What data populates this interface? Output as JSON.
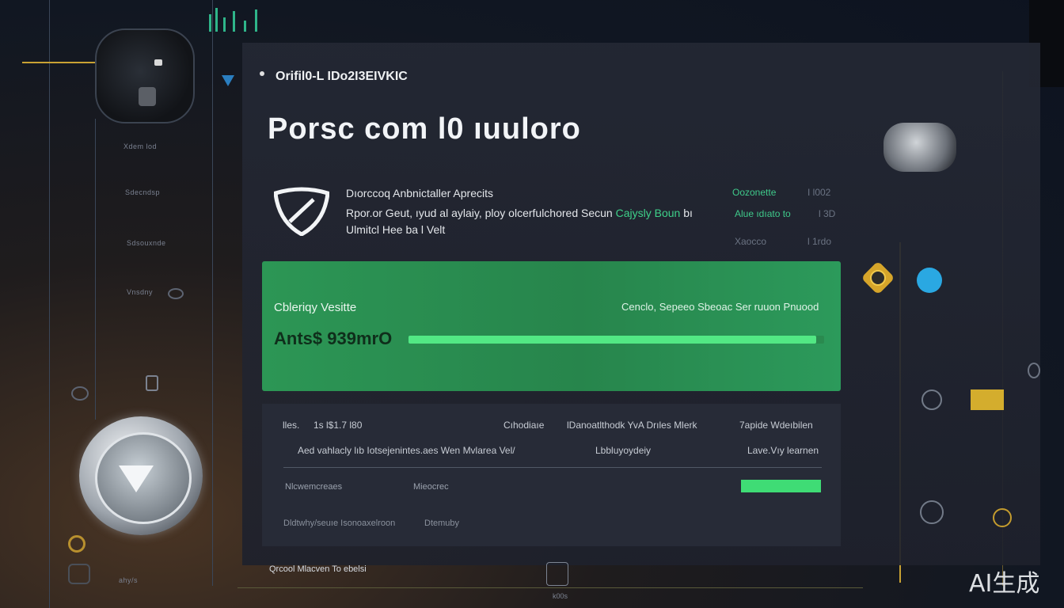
{
  "rail": {
    "labels": [
      "Xdem lod",
      "Sdecndsp",
      "Sdsouxnde",
      "Vnsdny"
    ]
  },
  "header": {
    "label": "Orifil0-L IDo2I3EIVKIC",
    "title": "Porsc com l0 ıuuloro"
  },
  "description": {
    "title": "Dıorccoq Anbnictaller Aprecits",
    "line1_prefix": "Rpor.or Geut, ıyud al aylaiy, ploy olcerfulchored Secun",
    "line1_highlight": "Cajysly Boun",
    "line1_suffix": "bı",
    "line2": "Ulmitcl Hee ba l Velt",
    "meta": {
      "a": "Oozonette",
      "b": "I  l002",
      "c": "Alue ıdıato to",
      "d": "l  3D",
      "e": "Xaocco",
      "f": "l  1rdo"
    }
  },
  "green_card": {
    "title": "Cbleriqy Vesitte",
    "right_text": "Cenclo, Sepeeo Sbeoac Ser ruuon Pnuood",
    "value": "Ants$ 939mrO",
    "progress_fraction": 0.98
  },
  "table": {
    "row1": {
      "a": "lles.",
      "b": "1s l$1.7 l80",
      "c": "Cıhodiaıe",
      "d": "lDanoatlthodk YvA Drıles Mlerk",
      "e": "7apide Wdeıbilen"
    },
    "row2": {
      "a": "Aed vahlacly lıb Iotsejenintes.aes Wen Mvlarea Vel/",
      "b": "Lbbluyoydeiy",
      "c": "Lave.Vıy learnen"
    },
    "row3": {
      "a": "Nlcwemcreaes",
      "b": "Mieocrec"
    },
    "row4": {
      "a": "Dldtwhy/seuıe  Isonoaxelroon",
      "b": "Dtemuby"
    },
    "progress_fraction": 1.0,
    "progress_color": "#3fdc75"
  },
  "footer": {
    "label": "Qrcool Mlacven  To ebelsi",
    "caption": "k00s",
    "rail_caption": "ahy/s"
  },
  "watermark": "AI生成",
  "colors": {
    "accent_green": "#3ed089",
    "card_green": "#2c9655",
    "gold": "#c9a233"
  }
}
